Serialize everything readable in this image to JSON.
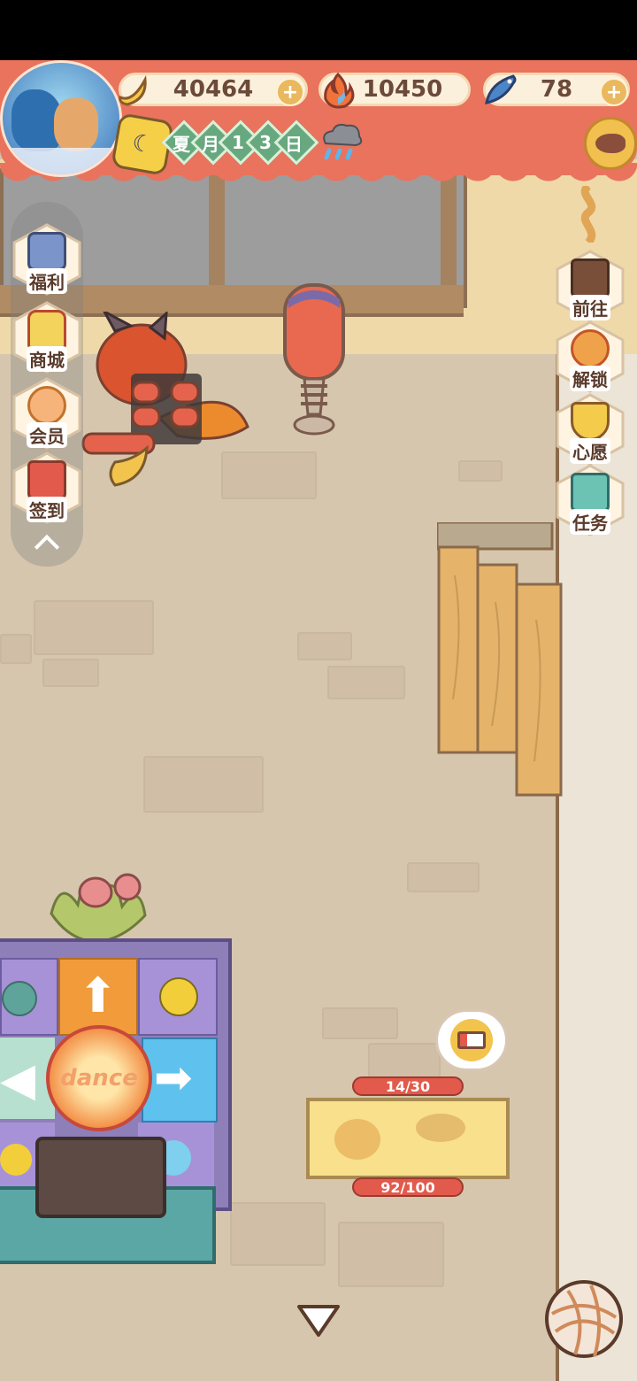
{
  "hud": {
    "banana_count": "40464",
    "fire_count": "10450",
    "fish_count": "78",
    "date": {
      "season": "夏",
      "month_label": "月",
      "day_digit1": "1",
      "day_digit2": "3",
      "day_label": "日"
    },
    "weather_icon": "rain-cloud-icon"
  },
  "left_menu": {
    "items": [
      {
        "label": "福利",
        "icon": "tv-icon"
      },
      {
        "label": "商城",
        "icon": "shop-icon"
      },
      {
        "label": "会员",
        "icon": "flower-badge-icon"
      },
      {
        "label": "签到",
        "icon": "calendar-icon"
      }
    ],
    "collapse_icon": "chevron-up-icon"
  },
  "right_menu": {
    "items": [
      {
        "label": "前往",
        "icon": "map-board-icon"
      },
      {
        "label": "解锁",
        "icon": "key-icon"
      },
      {
        "label": "心愿",
        "icon": "heart-book-icon"
      },
      {
        "label": "任务",
        "icon": "task-box-icon"
      }
    ]
  },
  "scene": {
    "dance_pad_text": "dance",
    "bed_energy": "14/30",
    "bed_condition": "92/100"
  },
  "colors": {
    "hud_red": "#e9735c",
    "floor": "#d6c6ae",
    "accent_green": "#68a87f"
  }
}
